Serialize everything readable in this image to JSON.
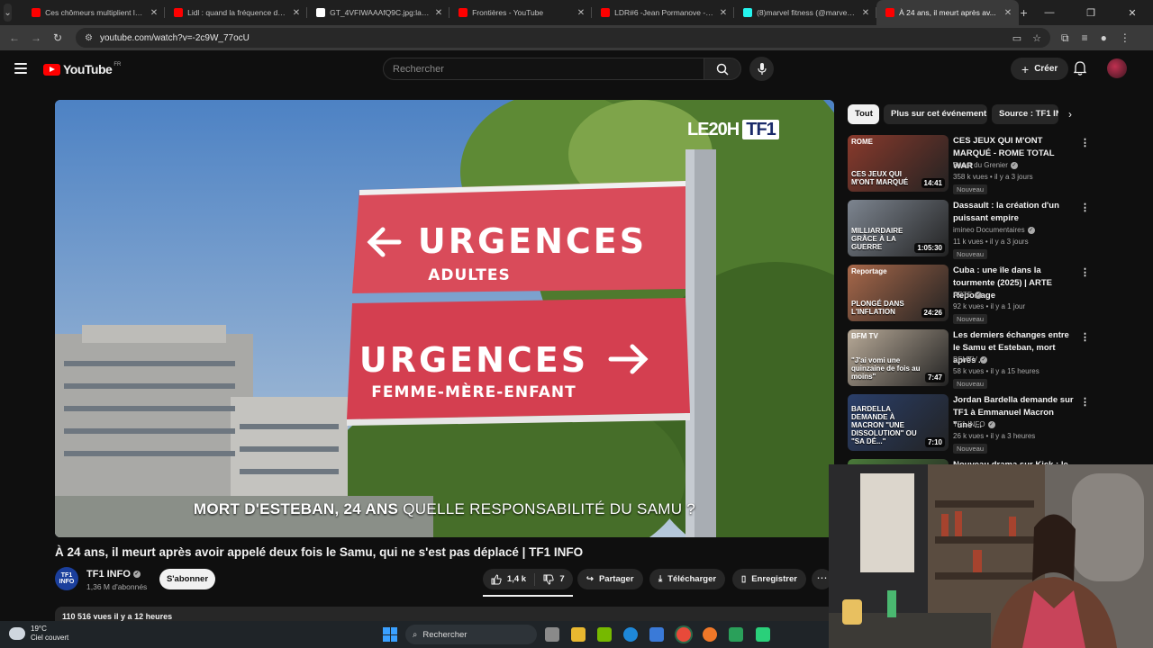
{
  "browser": {
    "tabs": [
      {
        "title": "Ces chômeurs multiplient les c...",
        "favicon": "youtube",
        "color": "#ff0000"
      },
      {
        "title": "Lidl : quand la fréquence de tr...",
        "favicon": "youtube",
        "color": "#ff0000"
      },
      {
        "title": "GT_4VFIWAAAfQ9C.jpg:large (...",
        "favicon": "x",
        "color": "#ffffff"
      },
      {
        "title": "Frontières - YouTube",
        "favicon": "youtube",
        "color": "#ff0000"
      },
      {
        "title": "LDR#6 -Jean Pormanove - Enqu...",
        "favicon": "youtube",
        "color": "#ff0000"
      },
      {
        "title": "(8)marvel fitness (@marvel.fit) ...",
        "favicon": "tiktok",
        "color": "#25f4ee"
      },
      {
        "title": "À 24 ans, il meurt après av...",
        "favicon": "youtube",
        "color": "#ff0000",
        "active": true
      }
    ],
    "url": "youtube.com/watch?v=-2c9W_77ocU"
  },
  "header": {
    "logo_text": "YouTube",
    "logo_country": "FR",
    "search_placeholder": "Rechercher",
    "create_label": "Créer"
  },
  "video": {
    "watermark_prefix": "LE20H",
    "watermark_brand": "TF1",
    "sign_top_line1": "URGENCES",
    "sign_top_line2": "ADULTES",
    "sign_bottom_line1": "URGENCES",
    "sign_bottom_line2": "FEMME-MÈRE-ENFANT",
    "caption_bold": "MORT D'ESTEBAN, 24 ANS",
    "caption_rest": "QUELLE RESPONSABILITÉ DU SAMU ?",
    "title": "À 24 ans, il meurt après avoir appelé deux fois le Samu, qui ne s'est pas déplacé | TF1 INFO",
    "views_line": "110 516 vues  il y a 12 heures"
  },
  "channel": {
    "avatar_text": "TF1 INFO",
    "name": "TF1 INFO",
    "subscribers": "1,36 M d'abonnés",
    "subscribe_label": "S'abonner"
  },
  "actions": {
    "likes": "1,4 k",
    "dislikes": "7",
    "share": "Partager",
    "download": "Télécharger",
    "save": "Enregistrer"
  },
  "chips": [
    "Tout",
    "Plus sur cet événement",
    "Source : TF1 INFO"
  ],
  "recommendations": [
    {
      "title": "CES JEUX QUI M'ONT MARQUÉ - ROME TOTAL WAR",
      "channel": "Bazar du Grenier",
      "meta": "358 k vues • il y a 3 jours",
      "badge": "Nouveau",
      "duration": "14:41",
      "thumb_text": "CES JEUX QUI M'ONT MARQUÉ",
      "thumb_label": "ROME",
      "thumb_color": "#8a3a2c"
    },
    {
      "title": "Dassault : la création d'un puissant empire",
      "channel": "imineo Documentaires",
      "meta": "11 k vues • il y a 3 jours",
      "badge": "Nouveau",
      "duration": "1:05:30",
      "thumb_text": "MILLIARDAIRE GRÂCE À LA GUERRE",
      "thumb_color": "#7d8590"
    },
    {
      "title": "Cuba : une île dans la tourmente (2025) | ARTE Reportage",
      "channel": "ARTE",
      "meta": "92 k vues • il y a 1 jour",
      "badge": "Nouveau",
      "duration": "24:26",
      "thumb_text": "PLONGÉ DANS L'INFLATION",
      "thumb_label": "Reportage",
      "thumb_color": "#a8684a"
    },
    {
      "title": "Les derniers échanges entre le Samu et Esteban, mort après ...",
      "channel": "BFMTV",
      "meta": "58 k vues • il y a 15 heures",
      "badge": "Nouveau",
      "duration": "7:47",
      "thumb_text": "\"J'ai vomi une quinzaine de fois au moins\"",
      "thumb_label": "BFM TV",
      "thumb_color": "#b8aa98"
    },
    {
      "title": "Jordan Bardella demande sur TF1 à Emmanuel Macron \"une ...",
      "channel": "TF1 INFO",
      "meta": "26 k vues • il y a 3 heures",
      "badge": "Nouveau",
      "duration": "7:10",
      "thumb_text": "BARDELLA DEMANDE À MACRON \"UNE DISSOLUTION\" OU \"SA DÉ...\"",
      "thumb_color": "#2a3f6a"
    },
    {
      "title": "Nouveau drama sur Kick : le fils ...",
      "duration": "",
      "thumb_text": "",
      "thumb_color": "#4a7a3a"
    }
  ],
  "taskbar": {
    "weather_temp": "19°C",
    "weather_desc": "Ciel couvert",
    "search_label": "Rechercher"
  }
}
